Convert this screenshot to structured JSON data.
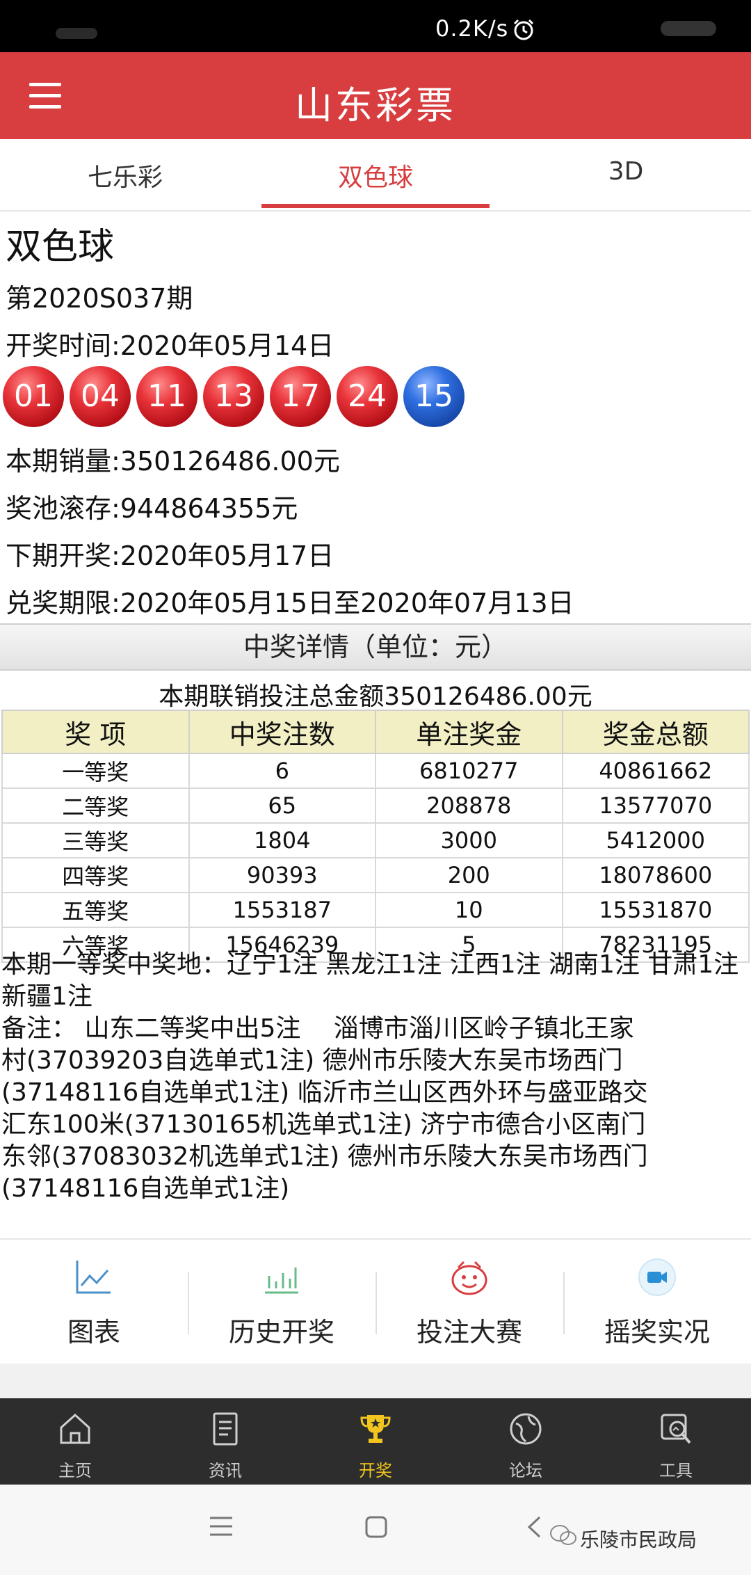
{
  "status_bar": {
    "network_speed": "0.2K/s"
  },
  "app_bar": {
    "title": "山东彩票"
  },
  "tabs": [
    {
      "label": "七乐彩"
    },
    {
      "label": "双色球"
    },
    {
      "label": "3D"
    }
  ],
  "lottery": {
    "name": "双色球",
    "issue": "第2020S037期",
    "draw_time": "开奖时间:2020年05月14日",
    "red_balls": [
      "01",
      "04",
      "11",
      "13",
      "17",
      "24"
    ],
    "blue_ball": "15",
    "sales": "本期销量:350126486.00元",
    "pool": "奖池滚存:944864355元",
    "next_draw": "下期开奖:2020年05月17日",
    "claim_period": "兑奖期限:2020年05月15日至2020年07月13日"
  },
  "details": {
    "section_title": "中奖详情（单位：元）",
    "total_line": "本期联销投注总金额350126486.00元",
    "columns": [
      "奖 项",
      "中奖注数",
      "单注奖金",
      "奖金总额"
    ],
    "rows": [
      [
        "一等奖",
        "6",
        "6810277",
        "40861662"
      ],
      [
        "二等奖",
        "65",
        "208878",
        "13577070"
      ],
      [
        "三等奖",
        "1804",
        "3000",
        "5412000"
      ],
      [
        "四等奖",
        "90393",
        "200",
        "18078600"
      ],
      [
        "五等奖",
        "1553187",
        "10",
        "15531870"
      ],
      [
        "六等奖",
        "15646239",
        "5",
        "78231195"
      ]
    ],
    "first_prize_locations": "本期一等奖中奖地：辽宁1注 黑龙江1注 江西1注 湖南1注 甘肃1注 新疆1注",
    "note_lines": [
      "备注： 山东二等奖中出5注　 淄博市淄川区岭子镇北王家",
      "村(37039203自选单式1注)  德州市乐陵大东吴市场西门",
      "(37148116自选单式1注)  临沂市兰山区西外环与盛亚路交",
      "汇东100米(37130165机选单式1注)  济宁市德合小区南门",
      "东邻(37083032机选单式1注)  德州市乐陵大东吴市场西门",
      "(37148116自选单式1注)"
    ]
  },
  "tools": [
    {
      "label": "图表",
      "icon": "line-chart-icon"
    },
    {
      "label": "历史开奖",
      "icon": "bar-chart-icon"
    },
    {
      "label": "投注大赛",
      "icon": "smiley-bag-icon"
    },
    {
      "label": "摇奖实况",
      "icon": "video-camera-icon"
    }
  ],
  "bottom_nav": [
    {
      "label": "主页",
      "icon": "home-icon"
    },
    {
      "label": "资讯",
      "icon": "news-icon"
    },
    {
      "label": "开奖",
      "icon": "trophy-icon"
    },
    {
      "label": "论坛",
      "icon": "forum-icon"
    },
    {
      "label": "工具",
      "icon": "tools-icon"
    }
  ],
  "watermark": "乐陵市民政局",
  "colors": {
    "brand_red": "#d83d3f",
    "active_gold": "#f2c51f",
    "table_header": "#f2efc5"
  }
}
